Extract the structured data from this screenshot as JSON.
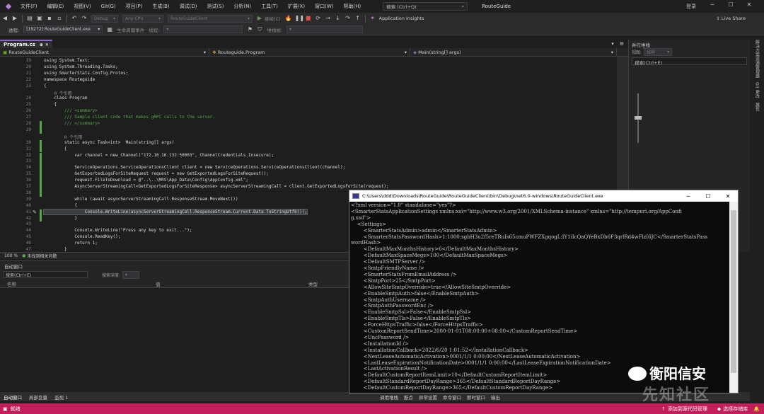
{
  "menubar": {
    "items": [
      "文件(F)",
      "编辑(E)",
      "视图(V)",
      "Git(G)",
      "项目(P)",
      "生成(B)",
      "调试(D)",
      "测试(S)",
      "分析(N)",
      "工具(T)",
      "扩展(X)",
      "窗口(W)",
      "帮助(H)"
    ],
    "search_label": "搜索 (Ctrl+Q)",
    "solution_name": "RouteGuide",
    "login": "登录"
  },
  "toolbar1": {
    "config": "Debug",
    "platform": "Any CPU",
    "startup": "RouteGuideClient",
    "continue": "继续(C)",
    "insights": "Application Insights",
    "live_share": "Live Share"
  },
  "toolbar2": {
    "process_label": "进程:",
    "process": "[19272] RouteGuideClient.exe",
    "lifecycle": "生命周期事件",
    "thread_label": "线程:",
    "stack_label": "堆栈帧:"
  },
  "editor": {
    "tab": "Program.cs",
    "nav_project": "RouteGuideClient",
    "nav_class": "Routeguide.Program",
    "nav_member": "Main(string[] args)",
    "lines": [
      {
        "n": "19",
        "t": "using System.Text;"
      },
      {
        "n": "20",
        "t": "using System.Threading.Tasks;"
      },
      {
        "n": "21",
        "t": "using SmarterStats.Config.Protos;"
      },
      {
        "n": "22",
        "t": "namespace Routeguide"
      },
      {
        "n": "23",
        "t": "{"
      },
      {
        "n": "",
        "t": "    0 个引用"
      },
      {
        "n": "24",
        "t": "    class Program"
      },
      {
        "n": "25",
        "t": "    {"
      },
      {
        "n": "26",
        "t": "        /// <summary>"
      },
      {
        "n": "27",
        "t": "        /// Sample client code that makes gRPC calls to the server."
      },
      {
        "n": "28",
        "t": "        /// </summary>"
      },
      {
        "n": "29",
        "t": ""
      },
      {
        "n": "",
        "t": "        0 个引用"
      },
      {
        "n": "30",
        "t": "        static async Task<int>  Main(string[] args)"
      },
      {
        "n": "31",
        "t": "        {"
      },
      {
        "n": "32",
        "t": "            var channel = new Channel(\"172.16.16.132:50003\", ChannelCredentials.Insecure);"
      },
      {
        "n": "33",
        "t": ""
      },
      {
        "n": "34",
        "t": "            ServiceOperations.ServiceOperationsClient client = new ServiceOperations.ServiceOperationsClient(channel);"
      },
      {
        "n": "35",
        "t": "            GetExportedLogsForSiteRequest request = new GetExportedLogsForSiteRequest();"
      },
      {
        "n": "36",
        "t": "            request.FileToDownload = @\"..\\..\\MRS\\App_Data\\Config\\AppConfig.xml\";"
      },
      {
        "n": "37",
        "t": "            AsyncServerStreamingCall<GetExportedLogsForSiteResponse> asyncServerStreamingCall = client.GetExportedLogsForSite(request);"
      },
      {
        "n": "38",
        "t": ""
      },
      {
        "n": "39",
        "t": "            while (await asyncServerStreamingCall.ResponseStream.MoveNext())"
      },
      {
        "n": "40",
        "t": "            {"
      },
      {
        "n": "41",
        "t": "                Console.WriteLine(asyncServerStreamingCall.ResponseStream.Current.Data.ToStringUtf8());"
      },
      {
        "n": "42",
        "t": "            }"
      },
      {
        "n": "43",
        "t": ""
      },
      {
        "n": "44",
        "t": "            Console.WriteLine(\"Press any key to exit...\");"
      },
      {
        "n": "45",
        "t": "            Console.ReadKey();"
      },
      {
        "n": "46",
        "t": "            return 1;"
      },
      {
        "n": "47",
        "t": "        }"
      }
    ]
  },
  "editor_status": {
    "zoom": "100 %",
    "issues": "未找到相关问题"
  },
  "right_panel": {
    "title": "并行堆栈",
    "view_label": "视图:",
    "view_value": "线程",
    "search": "搜索(Ctrl+E)"
  },
  "right_strip": {
    "tabs": [
      "解决方案资源管理器",
      "Git 更改",
      "属性"
    ]
  },
  "auto_window": {
    "title": "自动窗口",
    "search": "搜索(Ctrl+E)",
    "depth_label": "搜索深度:",
    "columns": [
      "名称",
      "值",
      "类型"
    ]
  },
  "bottom_tabs": [
    "自动窗口",
    "局部变量",
    "监视 1"
  ],
  "bottom_tabs_right": [
    "调用堆栈",
    "断点",
    "异常设置",
    "命令窗口",
    "即时窗口",
    "输出"
  ],
  "statusbar": {
    "ready": "就绪",
    "add_source": "添加到源代码管理",
    "select_repo": "选择存储库"
  },
  "console": {
    "title": "C:\\Users\\ddd\\Downloads\\RouteGuide\\RouteGuideClient\\bin\\Debug\\net6.0-windows\\RouteGuideClient.exe",
    "lines": [
      "<?xml version=\"1.0\" standalone=\"yes\"?>",
      "<SmarterStatsApplicationSettings xmlns:xsi=\"http://www.w3.org/2001/XMLSchema-instance\" xmlns=\"http://tempuri.org/AppConfi",
      "g.xsd\">",
      "    <Settings>",
      "        <SmarterStatsAdmin>admin</SmarterStatsAdmin>",
      "        <SmarterStatsPasswordHash>1:1000:sgbH3u2f5reTRuIs65cmuPWFZXgqogL:IY1iIcQaQYeBxDb6F3qrlRd4wFlzI6JC</SmarterStatsPass",
      "wordHash>",
      "        <DefaultMaxMonthsHistory>6</DefaultMaxMonthsHistory>",
      "        <DefaultMaxSpaceMegs>100</DefaultMaxSpaceMegs>",
      "        <DefaultSMTPServer />",
      "        <SmtpFriendlyName />",
      "        <SmarterStatsFromEmailAddress />",
      "        <SmtpPort>25</SmtpPort>",
      "        <AllowSiteSmtpOverride>true</AllowSiteSmtpOverride>",
      "        <EnableSmtpAuth>false</EnableSmtpAuth>",
      "        <SmtpAuthUsername />",
      "        <SmtpAuthPasswordEnc />",
      "        <EnableSmtpSsl>False</EnableSmtpSsl>",
      "        <EnableSmtpTls>False</EnableSmtpTls>",
      "        <ForceHttpsTraffic>false</ForceHttpsTraffic>",
      "        <CustomReportSendTime>2000-01-01T08:00:00+08:00</CustomReportSendTime>",
      "        <UncPassword />",
      "        <InstallationId />",
      "        <InstallationCallback>2022/6/20 1:01:52</InstallationCallback>",
      "        <NextLeaseAutomaticActivation>0001/1/1 0:00:00</NextLeaseAutomaticActivation>",
      "        <LastLeaseExpirationNotificationDate>0001/1/1 0:00:00</LastLeaseExpirationNotificationDate>",
      "        <LastActivationResult />",
      "        <DefaultCustomReportItemLimit>10</DefaultCustomReportItemLimit>",
      "        <DefaultStandardReportDayRange>365</DefaultStandardReportDayRange>",
      "        <DefaultCustomReportDayRange>365</DefaultCustomReportDayRange>"
    ]
  },
  "watermark": {
    "top": "衡阳信安",
    "bottom": "先知社区"
  }
}
